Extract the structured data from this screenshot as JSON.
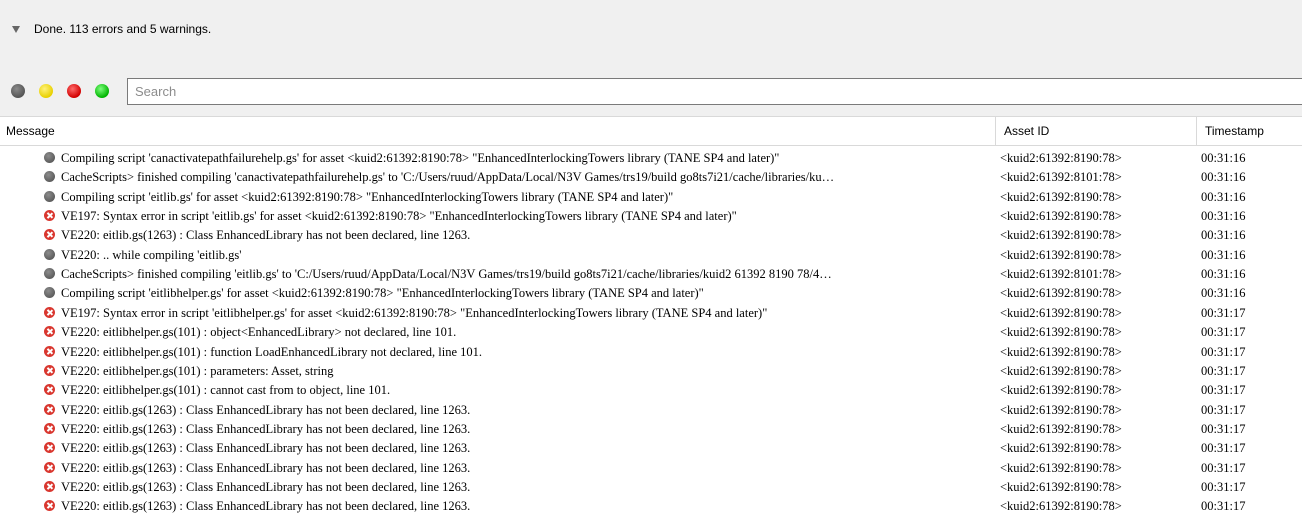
{
  "summary": {
    "text": "Done. 113 errors and 5 warnings."
  },
  "filters": {
    "search_placeholder": "Search",
    "dots": [
      "gray-filter",
      "yellow-filter",
      "red-filter",
      "green-filter"
    ]
  },
  "colors": {
    "error": "#d9372f",
    "info": "#666666",
    "accent_yellow": "#e8d000",
    "accent_red": "#d20000",
    "accent_green": "#00b400"
  },
  "table": {
    "headers": {
      "message": "Message",
      "asset_id": "Asset ID",
      "timestamp": "Timestamp"
    },
    "rows": [
      {
        "type": "info",
        "message": "Compiling script 'canactivatepathfailurehelp.gs' for asset <kuid2:61392:8190:78> \"EnhancedInterlockingTowers library (TANE SP4 and later)\"",
        "asset": "<kuid2:61392:8190:78>",
        "time": "00:31:16"
      },
      {
        "type": "info",
        "message": "CacheScripts> finished compiling 'canactivatepathfailurehelp.gs' to 'C:/Users/ruud/AppData/Local/N3V Games/trs19/build go8ts7i21/cache/libraries/ku…",
        "asset": "<kuid2:61392:8101:78>",
        "time": "00:31:16"
      },
      {
        "type": "info",
        "message": "Compiling script 'eitlib.gs' for asset <kuid2:61392:8190:78> \"EnhancedInterlockingTowers library (TANE SP4 and later)\"",
        "asset": "<kuid2:61392:8190:78>",
        "time": "00:31:16"
      },
      {
        "type": "error",
        "message": "VE197: Syntax error in script 'eitlib.gs' for asset <kuid2:61392:8190:78> \"EnhancedInterlockingTowers library (TANE SP4 and later)\"",
        "asset": "<kuid2:61392:8190:78>",
        "time": "00:31:16"
      },
      {
        "type": "error",
        "message": "VE220: eitlib.gs(1263) : Class EnhancedLibrary has not been declared, line 1263.",
        "asset": "<kuid2:61392:8190:78>",
        "time": "00:31:16"
      },
      {
        "type": "info",
        "message": "VE220: .. while compiling 'eitlib.gs'",
        "asset": "<kuid2:61392:8190:78>",
        "time": "00:31:16"
      },
      {
        "type": "info",
        "message": "CacheScripts> finished compiling 'eitlib.gs' to 'C:/Users/ruud/AppData/Local/N3V Games/trs19/build go8ts7i21/cache/libraries/kuid2 61392 8190 78/4…",
        "asset": "<kuid2:61392:8101:78>",
        "time": "00:31:16"
      },
      {
        "type": "info",
        "message": "Compiling script 'eitlibhelper.gs' for asset <kuid2:61392:8190:78> \"EnhancedInterlockingTowers library (TANE SP4 and later)\"",
        "asset": "<kuid2:61392:8190:78>",
        "time": "00:31:16"
      },
      {
        "type": "error",
        "message": "VE197: Syntax error in script 'eitlibhelper.gs' for asset <kuid2:61392:8190:78> \"EnhancedInterlockingTowers library (TANE SP4 and later)\"",
        "asset": "<kuid2:61392:8190:78>",
        "time": "00:31:17"
      },
      {
        "type": "error",
        "message": "VE220: eitlibhelper.gs(101) : object<EnhancedLibrary> not declared, line 101.",
        "asset": "<kuid2:61392:8190:78>",
        "time": "00:31:17"
      },
      {
        "type": "error",
        "message": "VE220: eitlibhelper.gs(101) : function LoadEnhancedLibrary not declared, line 101.",
        "asset": "<kuid2:61392:8190:78>",
        "time": "00:31:17"
      },
      {
        "type": "error",
        "message": "VE220: eitlibhelper.gs(101) :  parameters: Asset, string",
        "asset": "<kuid2:61392:8190:78>",
        "time": "00:31:17"
      },
      {
        "type": "error",
        "message": "VE220: eitlibhelper.gs(101) : cannot cast from  to object, line 101.",
        "asset": "<kuid2:61392:8190:78>",
        "time": "00:31:17"
      },
      {
        "type": "error",
        "message": "VE220: eitlib.gs(1263) : Class EnhancedLibrary has not been declared, line 1263.",
        "asset": "<kuid2:61392:8190:78>",
        "time": "00:31:17"
      },
      {
        "type": "error",
        "message": "VE220: eitlib.gs(1263) : Class EnhancedLibrary has not been declared, line 1263.",
        "asset": "<kuid2:61392:8190:78>",
        "time": "00:31:17"
      },
      {
        "type": "error",
        "message": "VE220: eitlib.gs(1263) : Class EnhancedLibrary has not been declared, line 1263.",
        "asset": "<kuid2:61392:8190:78>",
        "time": "00:31:17"
      },
      {
        "type": "error",
        "message": "VE220: eitlib.gs(1263) : Class EnhancedLibrary has not been declared, line 1263.",
        "asset": "<kuid2:61392:8190:78>",
        "time": "00:31:17"
      },
      {
        "type": "error",
        "message": "VE220: eitlib.gs(1263) : Class EnhancedLibrary has not been declared, line 1263.",
        "asset": "<kuid2:61392:8190:78>",
        "time": "00:31:17"
      },
      {
        "type": "error",
        "message": "VE220: eitlib.gs(1263) : Class EnhancedLibrary has not been declared, line 1263.",
        "asset": "<kuid2:61392:8190:78>",
        "time": "00:31:17"
      }
    ]
  }
}
